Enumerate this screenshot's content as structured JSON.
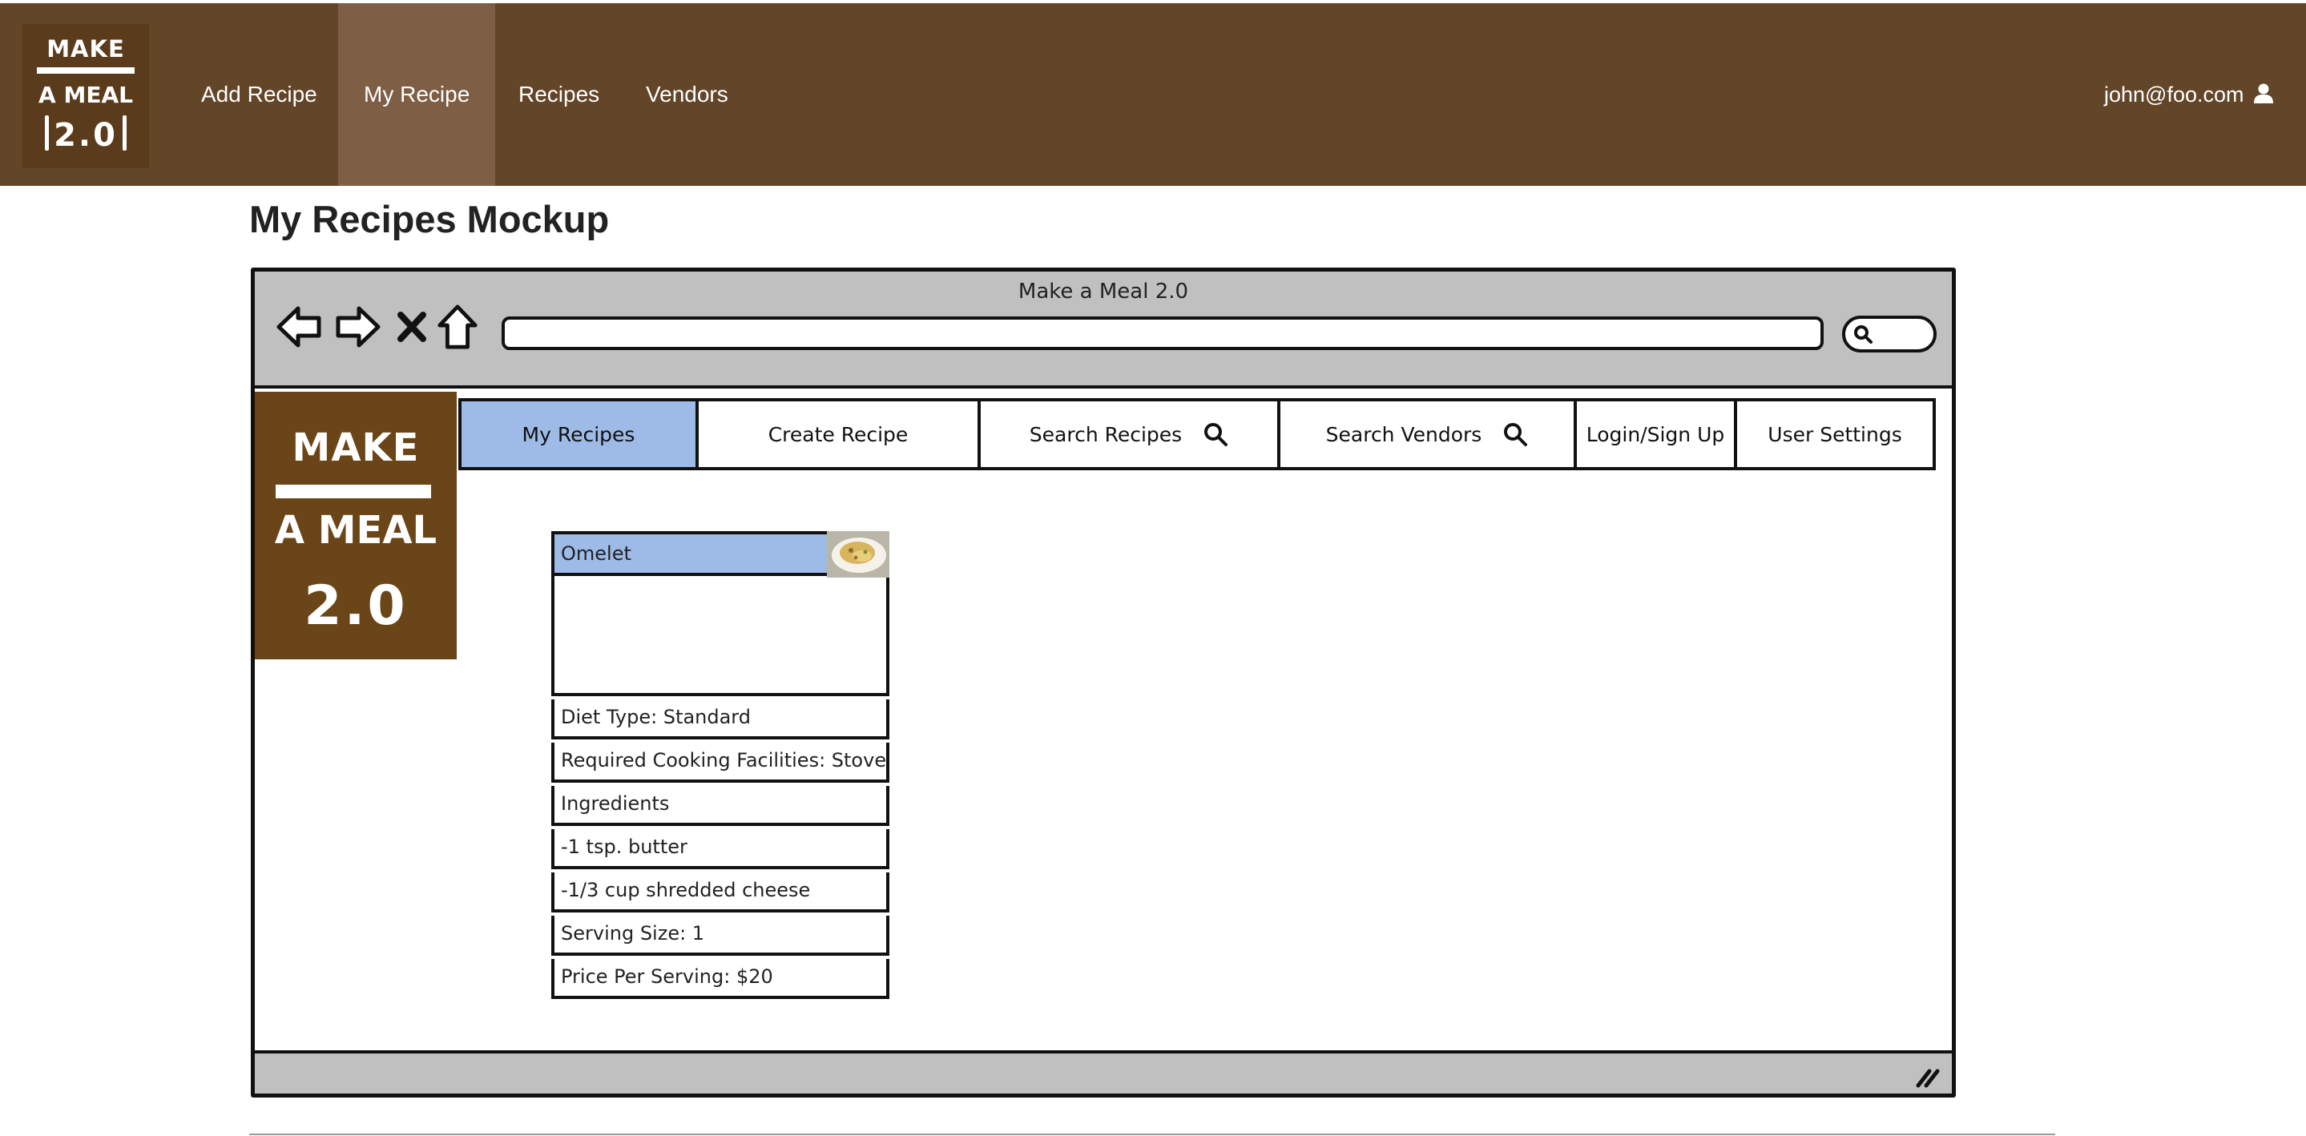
{
  "navbar": {
    "logo": {
      "line1": "MAKE",
      "line2": "A MEAL",
      "line3": "2.0"
    },
    "items": [
      {
        "label": "Add Recipe"
      },
      {
        "label": "My Recipe"
      },
      {
        "label": "Recipes"
      },
      {
        "label": "Vendors"
      }
    ],
    "active_item": "My Recipe",
    "user_email": "john@foo.com",
    "user_icon": "user-icon"
  },
  "page": {
    "title": "My Recipes Mockup"
  },
  "mockup": {
    "window_title": "Make a Meal 2.0",
    "browser_buttons": [
      "back-arrow-icon",
      "forward-arrow-icon",
      "close-x-icon",
      "home-icon"
    ],
    "url": "",
    "logo": {
      "line1": "MAKE",
      "line2": "A MEAL",
      "line3": "2.0"
    },
    "tabs": [
      {
        "label": "My Recipes",
        "active": true
      },
      {
        "label": "Create Recipe"
      },
      {
        "label": "Search Recipes",
        "icon": "search-icon"
      },
      {
        "label": "Search Vendors",
        "icon": "search-icon"
      },
      {
        "label": "Login/Sign Up"
      },
      {
        "label": "User Settings"
      }
    ],
    "recipe_card": {
      "name": "Omelet",
      "rows": [
        "Diet Type: Standard",
        "Required Cooking Facilities: Stove",
        "Ingredients",
        "-1 tsp. butter",
        "-1/3 cup shredded cheese",
        "Serving Size: 1",
        "Price Per Serving: $20"
      ]
    }
  },
  "colors": {
    "navbar": "#634528",
    "nav_active": "#7e5e44",
    "mock_logo": "#6a4517",
    "active_tab": "#9dbbe6",
    "chrome_gray": "#c0c0c0"
  }
}
